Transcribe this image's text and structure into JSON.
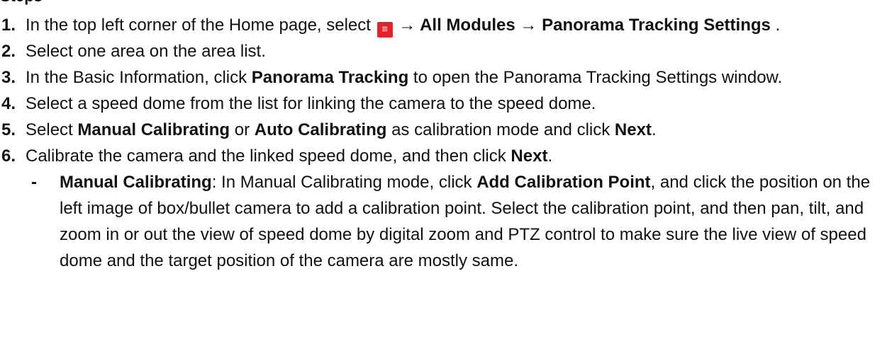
{
  "heading": "Steps",
  "steps": [
    {
      "num": "1.",
      "pre": "In the top left corner of the Home page, select",
      "menu_icon": "≡",
      "arrow1": " → ",
      "b1": "All Modules",
      "arrow2": " → ",
      "b2": "Panorama Tracking Settings",
      "post": " ."
    },
    {
      "num": "2.",
      "text": "Select one area on the area list."
    },
    {
      "num": "3.",
      "pre": "In the Basic Information, click ",
      "b1": "Panorama Tracking",
      "post": " to open the Panorama Tracking Settings window."
    },
    {
      "num": "4.",
      "text": "Select a speed dome from the list for linking the camera to the speed dome."
    },
    {
      "num": "5.",
      "pre": "Select ",
      "b1": "Manual Calibrating",
      "mid1": " or ",
      "b2": "Auto Calibrating",
      "mid2": " as calibration mode and click ",
      "b3": "Next",
      "post": "."
    },
    {
      "num": "6.",
      "pre": "Calibrate the camera and the linked speed dome, and then click ",
      "b1": "Next",
      "post": "."
    }
  ],
  "substep": {
    "bullet": "-",
    "b1": "Manual Calibrating",
    "mid1": ": In Manual Calibrating mode, click ",
    "b2": "Add Calibration Point",
    "post": ", and click the position on the left image of box/bullet camera to add a calibration point. Select the calibration point, and then pan, tilt, and zoom in or out the view of speed dome by digital zoom and PTZ control to make sure the live view of speed dome and the target position of the camera are mostly same."
  }
}
